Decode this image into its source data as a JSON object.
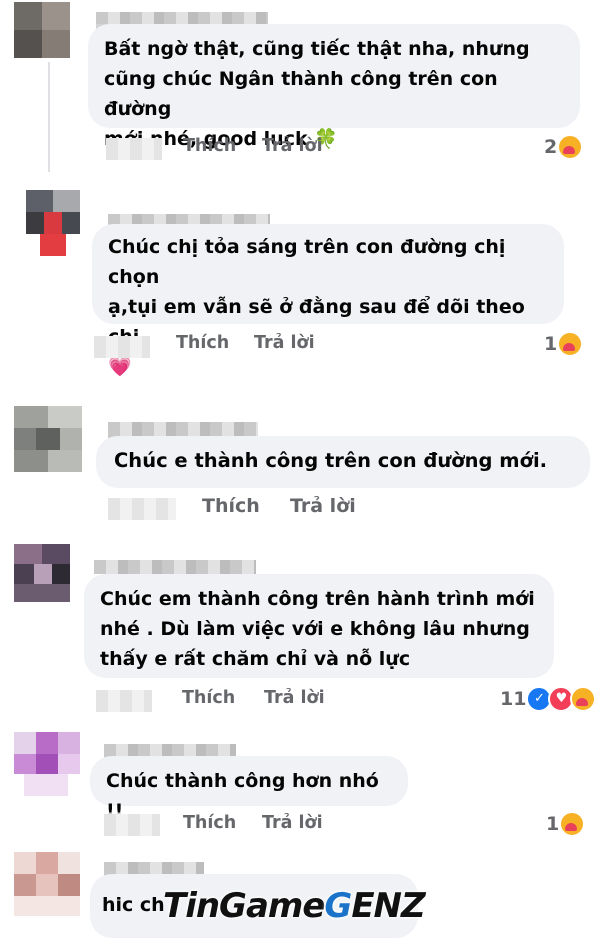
{
  "comments": [
    {
      "text": [
        "Bất ngờ thật, cũng tiếc thật nha, nhưng",
        "cũng chúc Ngân thành công trên con đường",
        "mới nhé, good luck 🍀"
      ],
      "like": "Thích",
      "reply": "Trả lời",
      "reaction_count": "2"
    },
    {
      "text": [
        "Chúc chị tỏa sáng trên con đường chị chọn",
        "ạ,tụi em vẫn sẽ ở đằng sau để dõi theo chị",
        "💗"
      ],
      "like": "Thích",
      "reply": "Trả lời",
      "reaction_count": "1"
    },
    {
      "text": [
        "Chúc e thành công trên con đường mới."
      ],
      "like": "Thích",
      "reply": "Trả lời",
      "reaction_count": ""
    },
    {
      "text": [
        "Chúc em thành công trên hành trình mới",
        "nhé . Dù làm việc với e không lâu nhưng",
        "thấy e rất chăm chỉ và nỗ lực"
      ],
      "like": "Thích",
      "reply": "Trả lời",
      "reaction_count": "11"
    },
    {
      "text": [
        "Chúc thành công hơn nhó !!"
      ],
      "like": "Thích",
      "reply": "Trả lời",
      "reaction_count": "1"
    },
    {
      "text": [
        "hic ch"
      ],
      "like": "",
      "reply": "",
      "reaction_count": ""
    }
  ],
  "watermark": {
    "part1": "TinGame",
    "part2": "G",
    "part3": "ENZ"
  },
  "colors": {
    "bubble": "#f0f2f5",
    "meta": "#65676b",
    "like_blue": "#1877f2",
    "love_red": "#f33e58",
    "care_yellow": "#f7b125"
  },
  "icons": [
    "clover-emoji",
    "pink-heart-emoji",
    "care-reaction-icon",
    "like-reaction-icon",
    "love-reaction-icon"
  ]
}
